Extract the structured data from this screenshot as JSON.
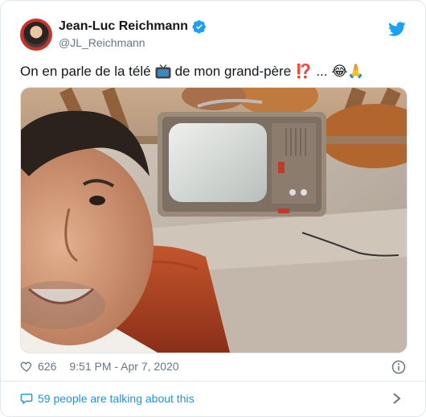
{
  "author": {
    "name": "Jean-Luc Reichmann",
    "handle": "@JL_Reichmann"
  },
  "tweet": {
    "text_before": "On en parle de la télé",
    "text_after": "de mon grand-père",
    "emoji_interrobang": "⁉️",
    "ellipsis": "...",
    "emoji_end": "😂🙏"
  },
  "stats": {
    "likes": "626",
    "timestamp": "9:51 PM - Apr 7, 2020"
  },
  "footer": {
    "talking": "59 people are talking about this"
  },
  "colors": {
    "twitter_blue": "#1da1f2",
    "link_blue": "#1b95e0",
    "muted": "#657786",
    "interrobang_red": "#e0245e"
  }
}
